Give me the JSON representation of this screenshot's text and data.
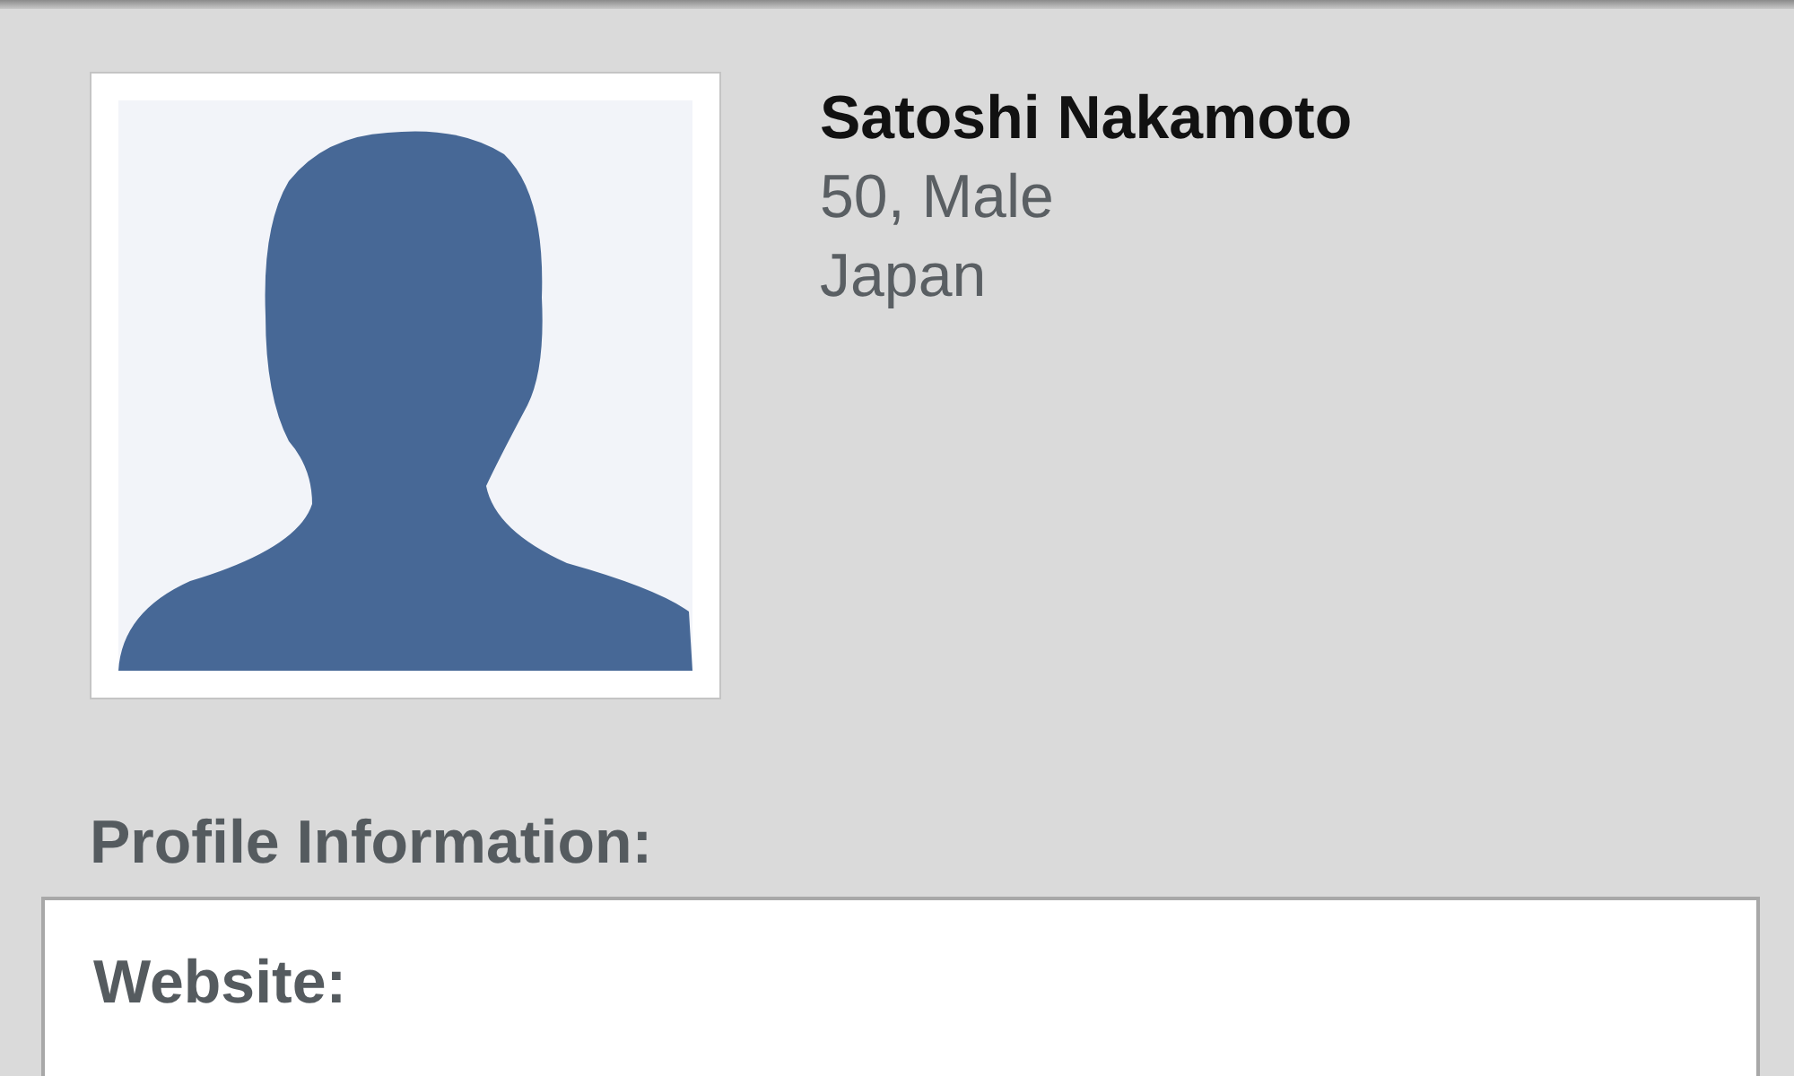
{
  "profile": {
    "name": "Satoshi Nakamoto",
    "age_gender": "50, Male",
    "location": "Japan"
  },
  "section": {
    "heading": "Profile Information:",
    "fields": [
      {
        "label": "Website:"
      }
    ]
  }
}
